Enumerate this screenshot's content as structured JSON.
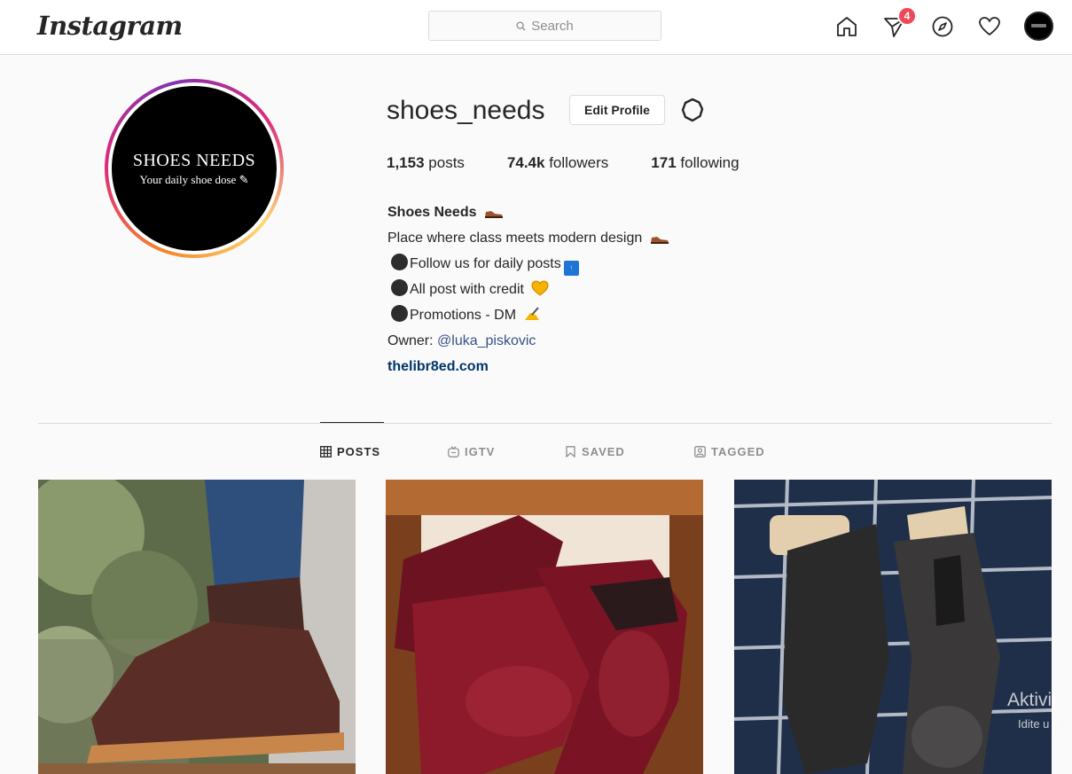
{
  "nav": {
    "logo": "Instagram",
    "search_placeholder": "Search",
    "badge_count": "4"
  },
  "profile": {
    "username": "shoes_needs",
    "edit_label": "Edit Profile",
    "avatar_line1": "SHOES NEEDS",
    "avatar_line2": "Your daily shoe dose",
    "stats": {
      "posts_count": "1,153",
      "posts_label": "posts",
      "followers_count": "74.4k",
      "followers_label": "followers",
      "following_count": "171",
      "following_label": "following"
    },
    "bio": {
      "name": "Shoes Needs",
      "line1": "Place where class meets modern design",
      "line2": "Follow us for daily posts",
      "line3": "All post with credit",
      "line4": "Promotions - DM",
      "owner_prefix": "Owner: ",
      "owner_mention": "@luka_piskovic",
      "website": "thelibr8ed.com"
    }
  },
  "tabs": {
    "posts": "POSTS",
    "igtv": "IGTV",
    "saved": "SAVED",
    "tagged": "TAGGED"
  },
  "overlay": {
    "line1": "Aktivir",
    "line2": "Idite u p"
  },
  "colors": {
    "badge": "#ed4956",
    "link": "#003569",
    "mention": "#385185"
  }
}
